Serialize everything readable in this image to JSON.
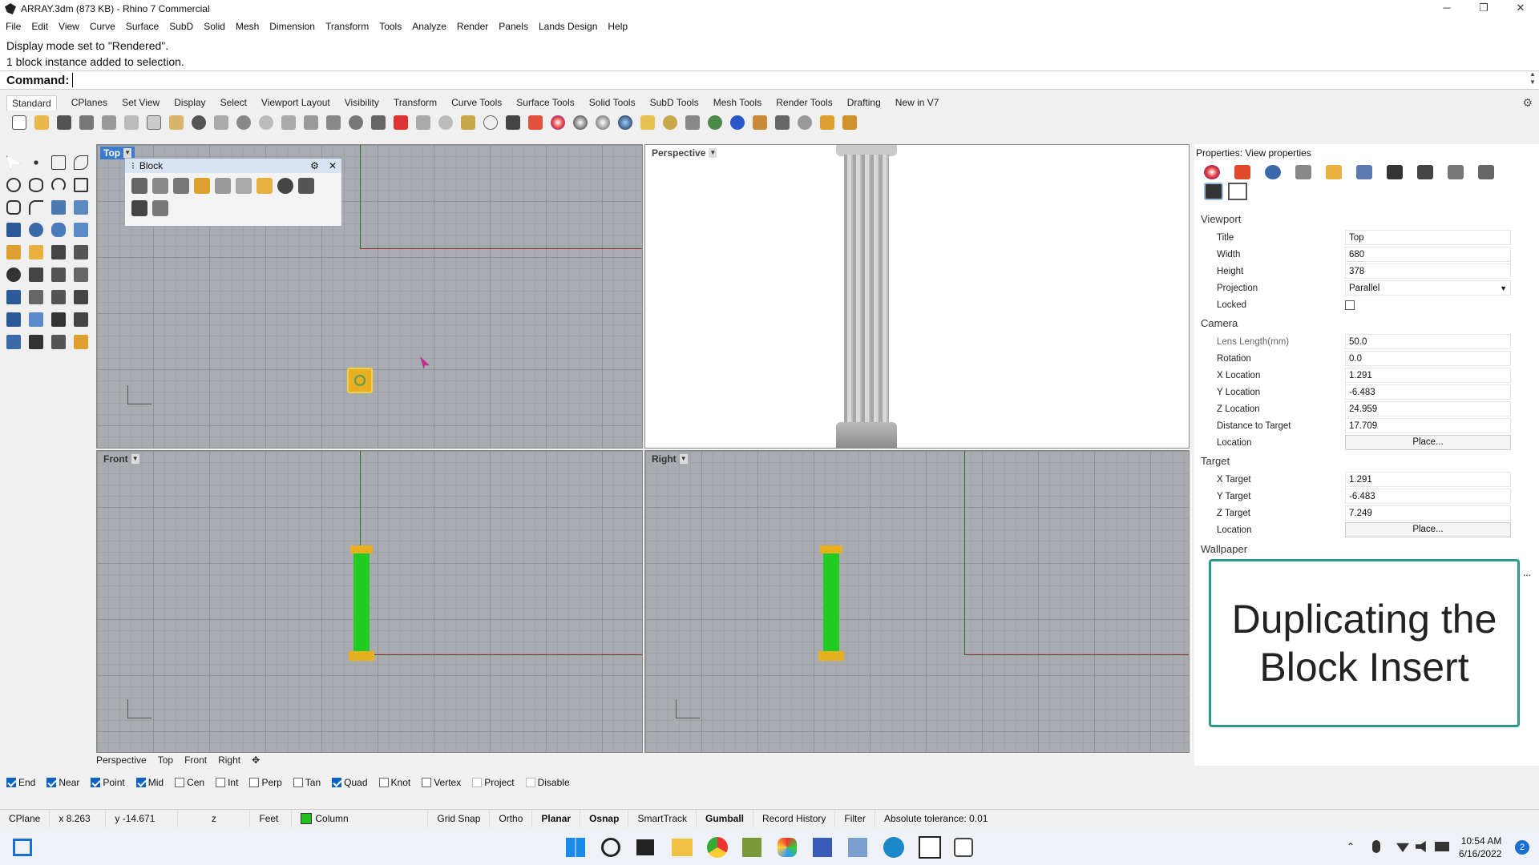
{
  "window": {
    "title": "ARRAY.3dm (873 KB) - Rhino 7 Commercial",
    "controls": [
      "─",
      "❐",
      "✕"
    ]
  },
  "menu": [
    "File",
    "Edit",
    "View",
    "Curve",
    "Surface",
    "SubD",
    "Solid",
    "Mesh",
    "Dimension",
    "Transform",
    "Tools",
    "Analyze",
    "Render",
    "Panels",
    "Lands Design",
    "Help"
  ],
  "command": {
    "history": [
      "Display mode set to \"Rendered\".",
      "1 block instance added to selection."
    ],
    "prompt": "Command:"
  },
  "tabs": [
    "Standard",
    "CPlanes",
    "Set View",
    "Display",
    "Select",
    "Viewport Layout",
    "Visibility",
    "Transform",
    "Curve Tools",
    "Surface Tools",
    "Solid Tools",
    "SubD Tools",
    "Mesh Tools",
    "Render Tools",
    "Drafting",
    "New in V7"
  ],
  "viewports": {
    "top": "Top",
    "perspective": "Perspective",
    "front": "Front",
    "right": "Right"
  },
  "block_panel": {
    "title": "Block"
  },
  "viewport_tabs": [
    "Perspective",
    "Top",
    "Front",
    "Right",
    "✥"
  ],
  "osnap": [
    {
      "label": "End",
      "on": true
    },
    {
      "label": "Near",
      "on": true
    },
    {
      "label": "Point",
      "on": true
    },
    {
      "label": "Mid",
      "on": true
    },
    {
      "label": "Cen",
      "on": false
    },
    {
      "label": "Int",
      "on": false
    },
    {
      "label": "Perp",
      "on": false
    },
    {
      "label": "Tan",
      "on": false
    },
    {
      "label": "Quad",
      "on": true
    },
    {
      "label": "Knot",
      "on": false
    },
    {
      "label": "Vertex",
      "on": false
    },
    {
      "label": "Project",
      "on": false
    },
    {
      "label": "Disable",
      "on": false
    }
  ],
  "status": {
    "cplane": "CPlane",
    "x": "x 8.263",
    "y": "y -14.671",
    "z": "z",
    "units": "Feet",
    "layer": "Column",
    "grid_snap": "Grid Snap",
    "ortho": "Ortho",
    "planar": "Planar",
    "osnap": "Osnap",
    "smarttrack": "SmartTrack",
    "gumball": "Gumball",
    "record_history": "Record History",
    "filter": "Filter",
    "tolerance": "Absolute tolerance: 0.01",
    "layer_color": "#22c022"
  },
  "properties": {
    "title": "Properties: View properties",
    "viewport_section": "Viewport",
    "viewport": [
      {
        "k": "Title",
        "v": "Top"
      },
      {
        "k": "Width",
        "v": "680"
      },
      {
        "k": "Height",
        "v": "378"
      },
      {
        "k": "Projection",
        "v": "Parallel"
      },
      {
        "k": "Locked",
        "v": ""
      }
    ],
    "camera_section": "Camera",
    "camera": [
      {
        "k": "Lens Length(mm)",
        "v": "50.0"
      },
      {
        "k": "Rotation",
        "v": "0.0"
      },
      {
        "k": "X Location",
        "v": "1.291"
      },
      {
        "k": "Y Location",
        "v": "-6.483"
      },
      {
        "k": "Z Location",
        "v": "24.959"
      },
      {
        "k": "Distance to Target",
        "v": "17.709"
      },
      {
        "k": "Location",
        "v": "Place..."
      }
    ],
    "target_section": "Target",
    "target": [
      {
        "k": "X Target",
        "v": "1.291"
      },
      {
        "k": "Y Target",
        "v": "-6.483"
      },
      {
        "k": "Z Target",
        "v": "7.249"
      },
      {
        "k": "Location",
        "v": "Place..."
      }
    ],
    "wallpaper_section": "Wallpaper"
  },
  "caption": "Duplicating the Block Insert",
  "clock": {
    "time": "10:54 AM",
    "date": "6/16/2022",
    "badge": "2"
  }
}
